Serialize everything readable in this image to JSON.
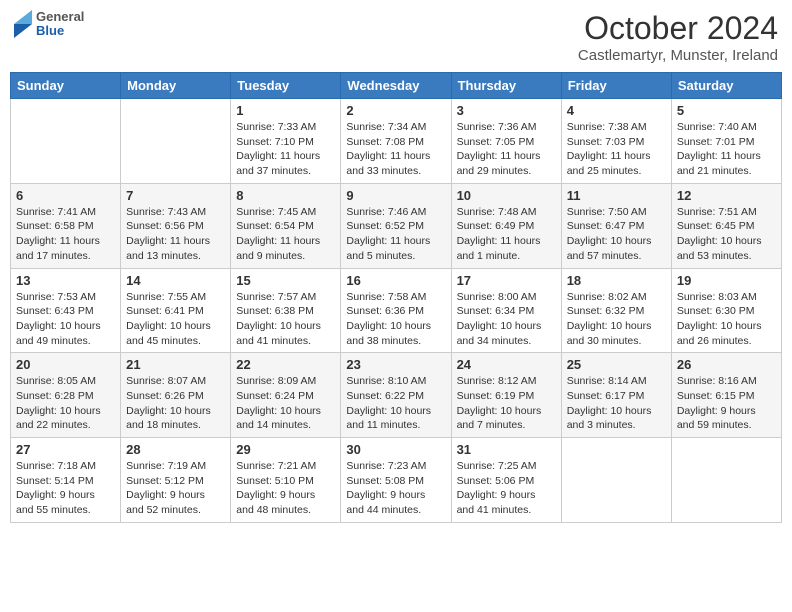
{
  "header": {
    "logo": {
      "general": "General",
      "blue": "Blue"
    },
    "title": "October 2024",
    "location": "Castlemartyr, Munster, Ireland"
  },
  "weekdays": [
    "Sunday",
    "Monday",
    "Tuesday",
    "Wednesday",
    "Thursday",
    "Friday",
    "Saturday"
  ],
  "weeks": [
    [
      {
        "day": "",
        "info": ""
      },
      {
        "day": "",
        "info": ""
      },
      {
        "day": "1",
        "info": "Sunrise: 7:33 AM\nSunset: 7:10 PM\nDaylight: 11 hours and 37 minutes."
      },
      {
        "day": "2",
        "info": "Sunrise: 7:34 AM\nSunset: 7:08 PM\nDaylight: 11 hours and 33 minutes."
      },
      {
        "day": "3",
        "info": "Sunrise: 7:36 AM\nSunset: 7:05 PM\nDaylight: 11 hours and 29 minutes."
      },
      {
        "day": "4",
        "info": "Sunrise: 7:38 AM\nSunset: 7:03 PM\nDaylight: 11 hours and 25 minutes."
      },
      {
        "day": "5",
        "info": "Sunrise: 7:40 AM\nSunset: 7:01 PM\nDaylight: 11 hours and 21 minutes."
      }
    ],
    [
      {
        "day": "6",
        "info": "Sunrise: 7:41 AM\nSunset: 6:58 PM\nDaylight: 11 hours and 17 minutes."
      },
      {
        "day": "7",
        "info": "Sunrise: 7:43 AM\nSunset: 6:56 PM\nDaylight: 11 hours and 13 minutes."
      },
      {
        "day": "8",
        "info": "Sunrise: 7:45 AM\nSunset: 6:54 PM\nDaylight: 11 hours and 9 minutes."
      },
      {
        "day": "9",
        "info": "Sunrise: 7:46 AM\nSunset: 6:52 PM\nDaylight: 11 hours and 5 minutes."
      },
      {
        "day": "10",
        "info": "Sunrise: 7:48 AM\nSunset: 6:49 PM\nDaylight: 11 hours and 1 minute."
      },
      {
        "day": "11",
        "info": "Sunrise: 7:50 AM\nSunset: 6:47 PM\nDaylight: 10 hours and 57 minutes."
      },
      {
        "day": "12",
        "info": "Sunrise: 7:51 AM\nSunset: 6:45 PM\nDaylight: 10 hours and 53 minutes."
      }
    ],
    [
      {
        "day": "13",
        "info": "Sunrise: 7:53 AM\nSunset: 6:43 PM\nDaylight: 10 hours and 49 minutes."
      },
      {
        "day": "14",
        "info": "Sunrise: 7:55 AM\nSunset: 6:41 PM\nDaylight: 10 hours and 45 minutes."
      },
      {
        "day": "15",
        "info": "Sunrise: 7:57 AM\nSunset: 6:38 PM\nDaylight: 10 hours and 41 minutes."
      },
      {
        "day": "16",
        "info": "Sunrise: 7:58 AM\nSunset: 6:36 PM\nDaylight: 10 hours and 38 minutes."
      },
      {
        "day": "17",
        "info": "Sunrise: 8:00 AM\nSunset: 6:34 PM\nDaylight: 10 hours and 34 minutes."
      },
      {
        "day": "18",
        "info": "Sunrise: 8:02 AM\nSunset: 6:32 PM\nDaylight: 10 hours and 30 minutes."
      },
      {
        "day": "19",
        "info": "Sunrise: 8:03 AM\nSunset: 6:30 PM\nDaylight: 10 hours and 26 minutes."
      }
    ],
    [
      {
        "day": "20",
        "info": "Sunrise: 8:05 AM\nSunset: 6:28 PM\nDaylight: 10 hours and 22 minutes."
      },
      {
        "day": "21",
        "info": "Sunrise: 8:07 AM\nSunset: 6:26 PM\nDaylight: 10 hours and 18 minutes."
      },
      {
        "day": "22",
        "info": "Sunrise: 8:09 AM\nSunset: 6:24 PM\nDaylight: 10 hours and 14 minutes."
      },
      {
        "day": "23",
        "info": "Sunrise: 8:10 AM\nSunset: 6:22 PM\nDaylight: 10 hours and 11 minutes."
      },
      {
        "day": "24",
        "info": "Sunrise: 8:12 AM\nSunset: 6:19 PM\nDaylight: 10 hours and 7 minutes."
      },
      {
        "day": "25",
        "info": "Sunrise: 8:14 AM\nSunset: 6:17 PM\nDaylight: 10 hours and 3 minutes."
      },
      {
        "day": "26",
        "info": "Sunrise: 8:16 AM\nSunset: 6:15 PM\nDaylight: 9 hours and 59 minutes."
      }
    ],
    [
      {
        "day": "27",
        "info": "Sunrise: 7:18 AM\nSunset: 5:14 PM\nDaylight: 9 hours and 55 minutes."
      },
      {
        "day": "28",
        "info": "Sunrise: 7:19 AM\nSunset: 5:12 PM\nDaylight: 9 hours and 52 minutes."
      },
      {
        "day": "29",
        "info": "Sunrise: 7:21 AM\nSunset: 5:10 PM\nDaylight: 9 hours and 48 minutes."
      },
      {
        "day": "30",
        "info": "Sunrise: 7:23 AM\nSunset: 5:08 PM\nDaylight: 9 hours and 44 minutes."
      },
      {
        "day": "31",
        "info": "Sunrise: 7:25 AM\nSunset: 5:06 PM\nDaylight: 9 hours and 41 minutes."
      },
      {
        "day": "",
        "info": ""
      },
      {
        "day": "",
        "info": ""
      }
    ]
  ]
}
